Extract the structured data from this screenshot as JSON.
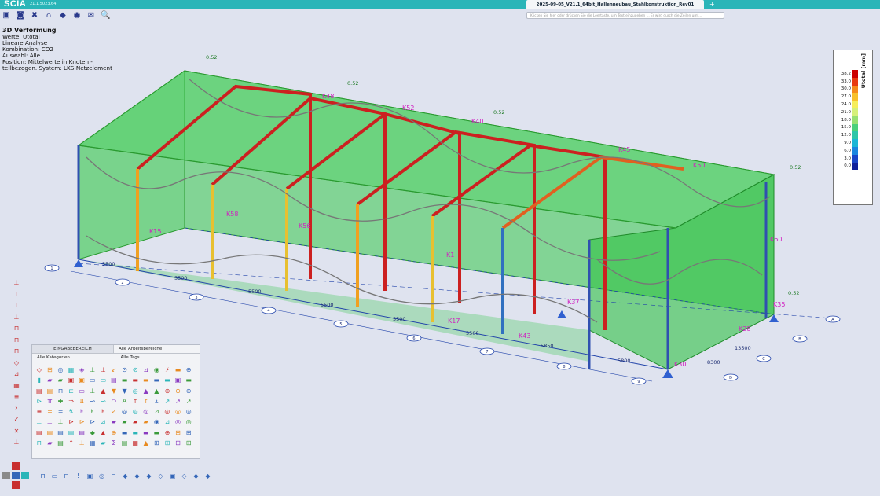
{
  "app": {
    "logo": "SCIA",
    "version": "21.1.5023.64",
    "tab_title": "2025-09-05_V21.1_64bit_Hallenneubau_Stahlkonstruktion_Rev01",
    "tab_add": "+",
    "command_placeholder": "Klicken Sie hier oder drücken Sie die Leertaste, um Text einzugeben ... Er wird durch die Zeilen umt..."
  },
  "top_toolbar": [
    {
      "name": "new-project-icon",
      "glyph": "▣"
    },
    {
      "name": "open-icon",
      "glyph": "◙"
    },
    {
      "name": "tools-icon",
      "glyph": "✖"
    },
    {
      "name": "structure-icon",
      "glyph": "⌂"
    },
    {
      "name": "model-icon",
      "glyph": "◆"
    },
    {
      "name": "view-icon",
      "glyph": "◉"
    },
    {
      "name": "mail-icon",
      "glyph": "✉"
    },
    {
      "name": "search-zoom-icon",
      "glyph": "🔍"
    }
  ],
  "info": {
    "title": "3D Verformung",
    "values": "Werte:  Utotal",
    "analysis": "Lineare  Analyse",
    "combination": "Kombination:  CO2",
    "selection": "Auswahl:  Alle",
    "position1": "Position:  Mittelwerte  in Knoten  -",
    "position2": "teilbezogen.  System:  LKS-Netzelement"
  },
  "legend": {
    "unit": "Utotal [mm]",
    "rows": [
      {
        "value": "38.2",
        "color": "#cc0000"
      },
      {
        "value": "33.0",
        "color": "#e83a10"
      },
      {
        "value": "30.0",
        "color": "#f58a1a"
      },
      {
        "value": "27.0",
        "color": "#f8c02a"
      },
      {
        "value": "24.0",
        "color": "#f6ee5a"
      },
      {
        "value": "21.0",
        "color": "#d6f07a"
      },
      {
        "value": "18.0",
        "color": "#98e072"
      },
      {
        "value": "15.0",
        "color": "#4ad07a"
      },
      {
        "value": "12.0",
        "color": "#2cc6a8"
      },
      {
        "value": "9.0",
        "color": "#1ab6d6"
      },
      {
        "value": "6.0",
        "color": "#1a86e0"
      },
      {
        "value": "3.0",
        "color": "#1a46c8"
      },
      {
        "value": "0.0",
        "color": "#10209a"
      }
    ]
  },
  "model": {
    "deform_label": "0.52",
    "dims": [
      "5500",
      "5500",
      "5500",
      "5500",
      "5500",
      "5500",
      "5850",
      "5800",
      "5300",
      "13500",
      "8300"
    ],
    "node_labels": [
      "K58",
      "K56",
      "K52",
      "K48",
      "K40",
      "K45",
      "K50",
      "K60",
      "K37",
      "K43",
      "K30",
      "K35",
      "K1",
      "K28",
      "K15",
      "K17"
    ],
    "axis_labels": [
      "1",
      "2",
      "3",
      "4",
      "5",
      "6",
      "7",
      "8",
      "9",
      "A",
      "B",
      "C",
      "D"
    ]
  },
  "left_toolbar": [
    {
      "name": "beam-tool-icon",
      "glyph": "⊥"
    },
    {
      "name": "column-tool-icon",
      "glyph": "⊥"
    },
    {
      "name": "support-tool-icon",
      "glyph": "⊥"
    },
    {
      "name": "load-tool-icon",
      "glyph": "⊥"
    },
    {
      "name": "frame-tool-icon",
      "glyph": "⊓"
    },
    {
      "name": "arch-tool-icon",
      "glyph": "⊓"
    },
    {
      "name": "surface-tool-icon",
      "glyph": "⊓"
    },
    {
      "name": "wall-tool-icon",
      "glyph": "◇"
    },
    {
      "name": "stairs-tool-icon",
      "glyph": "⊿"
    },
    {
      "name": "grid-tool-icon",
      "glyph": "▦"
    },
    {
      "name": "layer-tool-icon",
      "glyph": "≡"
    },
    {
      "name": "sum-tool-icon",
      "glyph": "Σ"
    },
    {
      "name": "check-tool-icon",
      "glyph": "✓"
    },
    {
      "name": "delete-tool-icon",
      "glyph": "✕"
    },
    {
      "name": "axis-tool-icon",
      "glyph": "⊥"
    }
  ],
  "panel": {
    "tab1": "EINGABEBEREICH",
    "tab2": "Alle Arbeitsbereiche",
    "filter1": "Alle Kategorien",
    "filter2": "Alle Tags",
    "icons": [
      "◇",
      "⊞",
      "◎",
      "▦",
      "◈",
      "⊥",
      "⊥",
      "↙",
      "⊙",
      "⊘",
      "⊿",
      "◉",
      "⚡",
      "▬",
      "⊕",
      "▮",
      "▰",
      "▰",
      "▣",
      "▣",
      "▭",
      "▭",
      "▤",
      "▬",
      "▬",
      "▬",
      "▬",
      "▬",
      "▣",
      "▬",
      "▤",
      "▤",
      "⊓",
      "⊏",
      "▭",
      "⊥",
      "▲",
      "▼",
      "▼",
      "◎",
      "▲",
      "▲",
      "⊕",
      "⊕",
      "⊕",
      "⊳",
      "⇈",
      "✚",
      "⇒",
      "⇊",
      "⊸",
      "⊸",
      "◠",
      "Ａ",
      "↑",
      "↑",
      "Σ",
      "↗",
      "↗",
      "↗",
      "≡",
      "≐",
      "≐",
      "↯",
      "⊧",
      "⊧",
      "⊧",
      "↙",
      "◎",
      "◎",
      "◎",
      "⊿",
      "◎",
      "◎",
      "◎",
      "⊥",
      "⊥",
      "⊥",
      "⊳",
      "⊳",
      "⊳",
      "⊿",
      "▰",
      "▰",
      "▰",
      "▰",
      "◉",
      "⊿",
      "◎",
      "◎",
      "▤",
      "▤",
      "▤",
      "▤",
      "▤",
      "◆",
      "▲",
      "⊕",
      "▬",
      "▬",
      "▬",
      "▬",
      "⊕",
      "⊞",
      "⊞",
      "⊓",
      "▰",
      "▤",
      "↑",
      "⊥",
      "▦",
      "▰",
      "Σ",
      "▤",
      "▦",
      "▲",
      "⊞",
      "⊞",
      "⊞",
      "⊞"
    ]
  },
  "bottom_toolbar": [
    {
      "name": "node-icon",
      "glyph": "⊓"
    },
    {
      "name": "beam-icon",
      "glyph": "▭"
    },
    {
      "name": "frame-icon",
      "glyph": "⊓"
    },
    {
      "name": "alert-icon",
      "glyph": "!"
    },
    {
      "name": "view-front-icon",
      "glyph": "▣"
    },
    {
      "name": "view-side-icon",
      "glyph": "◎"
    },
    {
      "name": "view-top-icon",
      "glyph": "⊓"
    },
    {
      "name": "render-icon",
      "glyph": "◆"
    },
    {
      "name": "wire-icon",
      "glyph": "◆"
    },
    {
      "name": "shade-icon",
      "glyph": "◆"
    },
    {
      "name": "hide-icon",
      "glyph": "◇"
    },
    {
      "name": "section-icon",
      "glyph": "▣"
    },
    {
      "name": "clip-icon",
      "glyph": "◇"
    },
    {
      "name": "layers-icon",
      "glyph": "◆"
    },
    {
      "name": "display-icon",
      "glyph": "◆"
    }
  ]
}
